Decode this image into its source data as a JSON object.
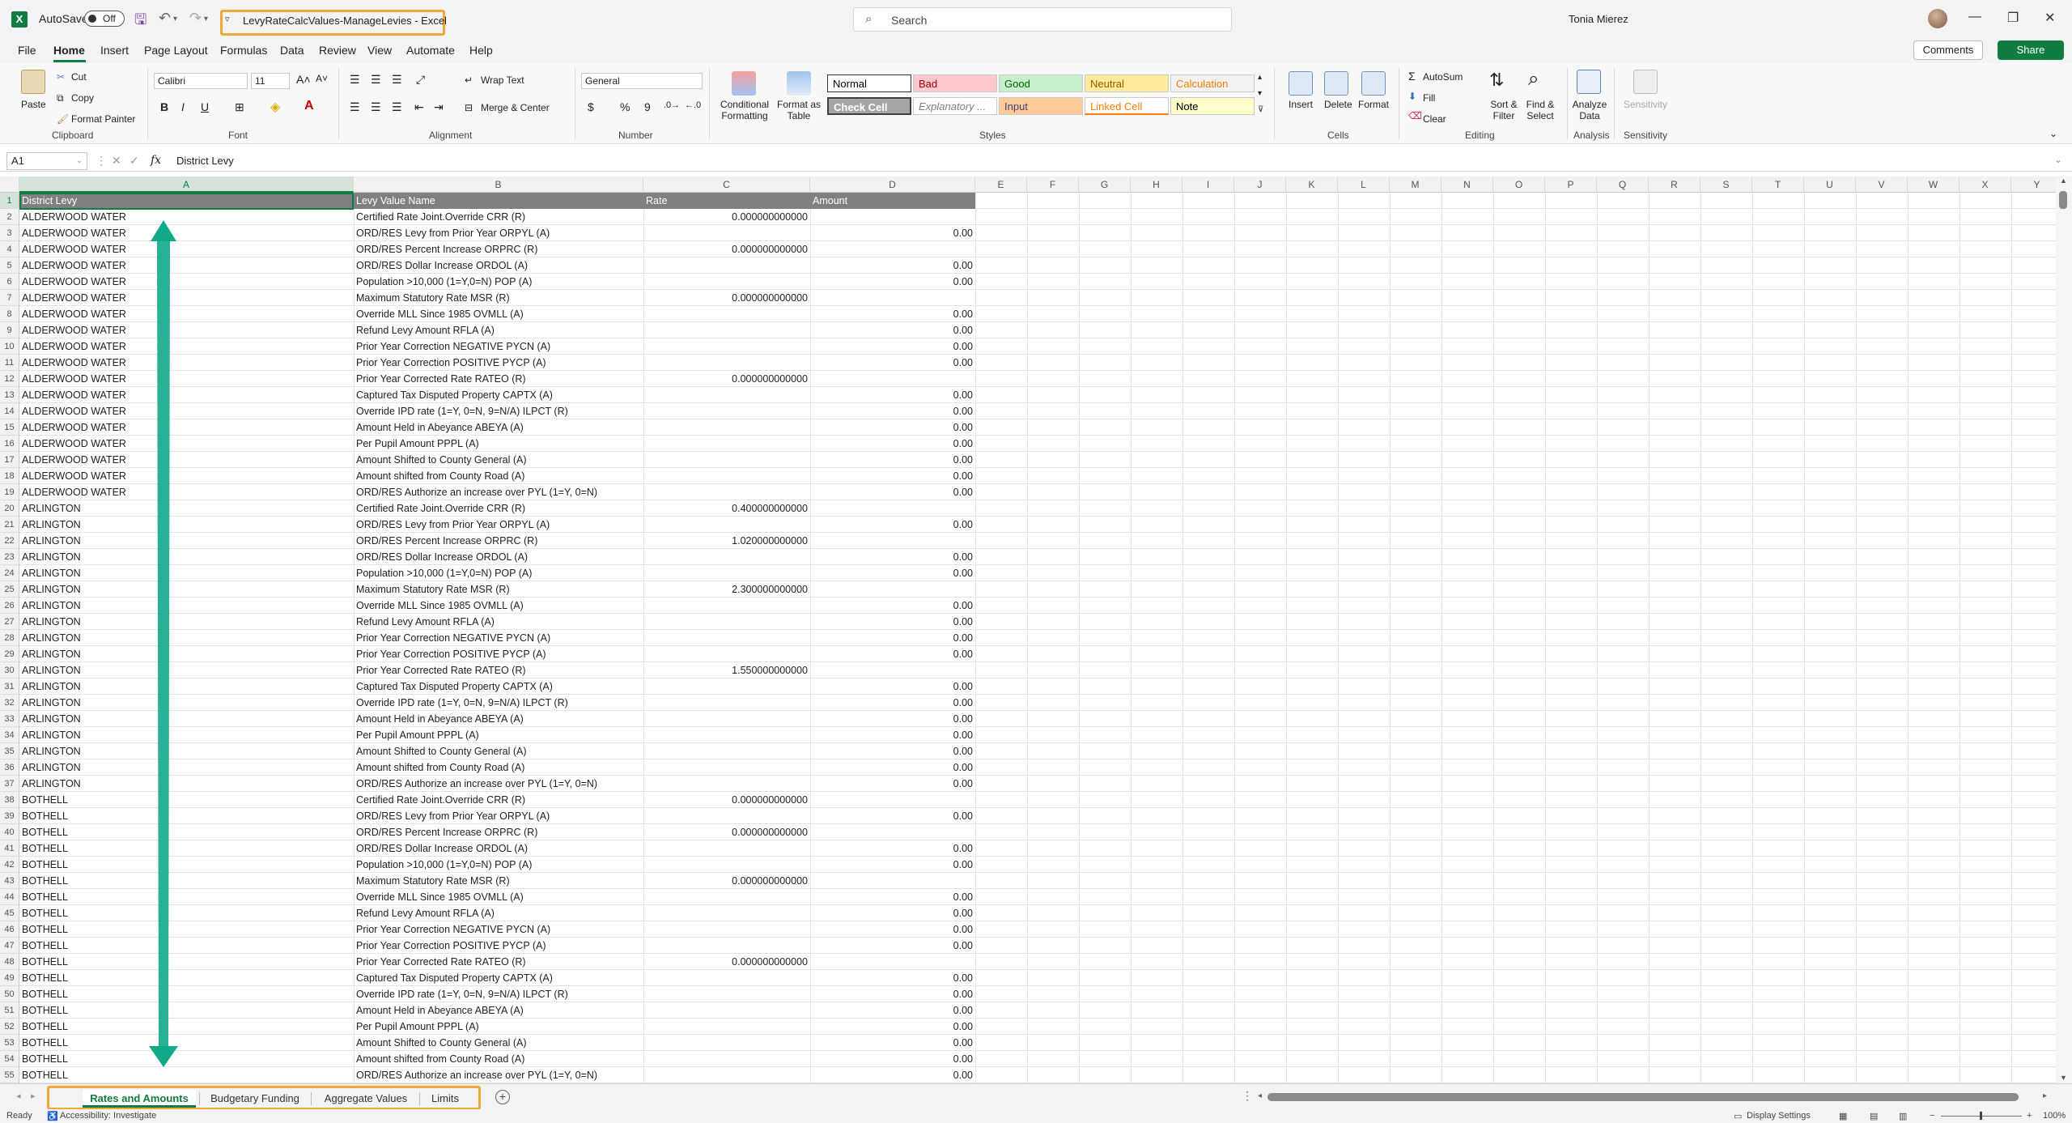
{
  "titlebar": {
    "autosave_label": "AutoSave",
    "autosave_state": "Off",
    "document_title": "LevyRateCalcValues-ManageLevies  -  Excel",
    "search_placeholder": "Search",
    "user_name": "Tonia Mierez"
  },
  "menu": {
    "tabs": [
      "File",
      "Home",
      "Insert",
      "Page Layout",
      "Formulas",
      "Data",
      "Review",
      "View",
      "Automate",
      "Help"
    ],
    "active_tab": "Home",
    "comments_label": "Comments",
    "share_label": "Share"
  },
  "ribbon": {
    "clipboard": {
      "paste": "Paste",
      "cut": "Cut",
      "copy": "Copy",
      "format_painter": "Format Painter",
      "label": "Clipboard"
    },
    "font": {
      "name": "Calibri",
      "size": "11",
      "label": "Font",
      "bold": "B",
      "italic": "I",
      "underline": "U"
    },
    "alignment": {
      "wrap_text": "Wrap Text",
      "merge_center": "Merge & Center",
      "label": "Alignment"
    },
    "number": {
      "format": "General",
      "label": "Number",
      "currency": "$",
      "percent": "%",
      "comma": "9"
    },
    "styles": {
      "conditional_formatting": "Conditional Formatting",
      "format_as_table": "Format as Table",
      "label": "Styles",
      "cells": [
        {
          "name": "Normal",
          "bg": "#ffffff",
          "color": "#000000"
        },
        {
          "name": "Bad",
          "bg": "#ffc7ce",
          "color": "#9c0006"
        },
        {
          "name": "Good",
          "bg": "#c6efce",
          "color": "#006100"
        },
        {
          "name": "Neutral",
          "bg": "#ffeb9c",
          "color": "#9c5700"
        },
        {
          "name": "Calculation",
          "bg": "#f2f2f2",
          "color": "#fa7d00"
        },
        {
          "name": "Check Cell",
          "bg": "#a5a5a5",
          "color": "#ffffff"
        },
        {
          "name": "Explanatory ...",
          "bg": "#ffffff",
          "color": "#7f7f7f"
        },
        {
          "name": "Input",
          "bg": "#ffcc99",
          "color": "#3f3f76"
        },
        {
          "name": "Linked Cell",
          "bg": "#ffffff",
          "color": "#fa7d00"
        },
        {
          "name": "Note",
          "bg": "#ffffcc",
          "color": "#000000"
        }
      ]
    },
    "cells": {
      "insert": "Insert",
      "delete": "Delete",
      "format": "Format",
      "label": "Cells"
    },
    "editing": {
      "autosum": "AutoSum",
      "fill": "Fill",
      "clear": "Clear",
      "sort_filter": "Sort & Filter",
      "find_select": "Find & Select",
      "label": "Editing"
    },
    "analysis": {
      "analyze_data": "Analyze Data",
      "label": "Analysis"
    },
    "sensitivity": {
      "sensitivity": "Sensitivity",
      "label": "Sensitivity"
    }
  },
  "formula_bar": {
    "name_box": "A1",
    "fx": "fx",
    "content": "District Levy"
  },
  "columns": [
    "A",
    "B",
    "C",
    "D",
    "E",
    "F",
    "G",
    "H",
    "I",
    "J",
    "K",
    "L",
    "M",
    "N",
    "O",
    "P",
    "Q",
    "R",
    "S",
    "T",
    "U",
    "V",
    "W",
    "X",
    "Y"
  ],
  "header_row": [
    "District Levy",
    "Levy Value Name",
    "Rate",
    "Amount"
  ],
  "rows": [
    [
      "ALDERWOOD WATER",
      "Certified Rate Joint.Override CRR (R)",
      "0.000000000000",
      ""
    ],
    [
      "ALDERWOOD WATER",
      "ORD/RES Levy from Prior Year ORPYL (A)",
      "",
      "0.00"
    ],
    [
      "ALDERWOOD WATER",
      "ORD/RES Percent Increase ORPRC (R)",
      "0.000000000000",
      ""
    ],
    [
      "ALDERWOOD WATER",
      "ORD/RES Dollar Increase ORDOL (A)",
      "",
      "0.00"
    ],
    [
      "ALDERWOOD WATER",
      "Population >10,000 (1=Y,0=N) POP (A)",
      "",
      "0.00"
    ],
    [
      "ALDERWOOD WATER",
      "Maximum Statutory Rate MSR (R)",
      "0.000000000000",
      ""
    ],
    [
      "ALDERWOOD WATER",
      "Override MLL Since 1985 OVMLL (A)",
      "",
      "0.00"
    ],
    [
      "ALDERWOOD WATER",
      "Refund Levy Amount  RFLA (A)",
      "",
      "0.00"
    ],
    [
      "ALDERWOOD WATER",
      "Prior Year Correction NEGATIVE  PYCN (A)",
      "",
      "0.00"
    ],
    [
      "ALDERWOOD WATER",
      "Prior Year Correction POSITIVE PYCP (A)",
      "",
      "0.00"
    ],
    [
      "ALDERWOOD WATER",
      "Prior Year Corrected Rate RATEO (R)",
      "0.000000000000",
      ""
    ],
    [
      "ALDERWOOD WATER",
      "Captured Tax Disputed Property CAPTX (A)",
      "",
      "0.00"
    ],
    [
      "ALDERWOOD WATER",
      "Override IPD rate (1=Y, 0=N, 9=N/A) ILPCT (R)",
      "",
      "0.00"
    ],
    [
      "ALDERWOOD WATER",
      "Amount Held in Abeyance ABEYA (A)",
      "",
      "0.00"
    ],
    [
      "ALDERWOOD WATER",
      "Per Pupil Amount  PPPL (A)",
      "",
      "0.00"
    ],
    [
      "ALDERWOOD WATER",
      "Amount Shifted to County General (A)",
      "",
      "0.00"
    ],
    [
      "ALDERWOOD WATER",
      "Amount shifted from County Road (A)",
      "",
      "0.00"
    ],
    [
      "ALDERWOOD WATER",
      "ORD/RES Authorize an increase over PYL (1=Y, 0=N)",
      "",
      "0.00"
    ],
    [
      "ARLINGTON",
      "Certified Rate Joint.Override CRR (R)",
      "0.400000000000",
      ""
    ],
    [
      "ARLINGTON",
      "ORD/RES Levy from Prior Year ORPYL (A)",
      "",
      "0.00"
    ],
    [
      "ARLINGTON",
      "ORD/RES Percent Increase ORPRC (R)",
      "1.020000000000",
      ""
    ],
    [
      "ARLINGTON",
      "ORD/RES Dollar Increase ORDOL (A)",
      "",
      "0.00"
    ],
    [
      "ARLINGTON",
      "Population >10,000 (1=Y,0=N) POP (A)",
      "",
      "0.00"
    ],
    [
      "ARLINGTON",
      "Maximum Statutory Rate MSR (R)",
      "2.300000000000",
      ""
    ],
    [
      "ARLINGTON",
      "Override MLL Since 1985 OVMLL (A)",
      "",
      "0.00"
    ],
    [
      "ARLINGTON",
      "Refund Levy Amount  RFLA (A)",
      "",
      "0.00"
    ],
    [
      "ARLINGTON",
      "Prior Year Correction NEGATIVE  PYCN (A)",
      "",
      "0.00"
    ],
    [
      "ARLINGTON",
      "Prior Year Correction POSITIVE PYCP (A)",
      "",
      "0.00"
    ],
    [
      "ARLINGTON",
      "Prior Year Corrected Rate RATEO (R)",
      "1.550000000000",
      ""
    ],
    [
      "ARLINGTON",
      "Captured Tax Disputed Property CAPTX (A)",
      "",
      "0.00"
    ],
    [
      "ARLINGTON",
      "Override IPD rate (1=Y, 0=N, 9=N/A) ILPCT (R)",
      "",
      "0.00"
    ],
    [
      "ARLINGTON",
      "Amount Held in Abeyance ABEYA (A)",
      "",
      "0.00"
    ],
    [
      "ARLINGTON",
      "Per Pupil Amount  PPPL (A)",
      "",
      "0.00"
    ],
    [
      "ARLINGTON",
      "Amount Shifted to County General (A)",
      "",
      "0.00"
    ],
    [
      "ARLINGTON",
      "Amount shifted from County Road (A)",
      "",
      "0.00"
    ],
    [
      "ARLINGTON",
      "ORD/RES Authorize an increase over PYL (1=Y, 0=N)",
      "",
      "0.00"
    ],
    [
      "BOTHELL",
      "Certified Rate Joint.Override CRR (R)",
      "0.000000000000",
      ""
    ],
    [
      "BOTHELL",
      "ORD/RES Levy from Prior Year ORPYL (A)",
      "",
      "0.00"
    ],
    [
      "BOTHELL",
      "ORD/RES Percent Increase ORPRC (R)",
      "0.000000000000",
      ""
    ],
    [
      "BOTHELL",
      "ORD/RES Dollar Increase ORDOL (A)",
      "",
      "0.00"
    ],
    [
      "BOTHELL",
      "Population >10,000 (1=Y,0=N) POP (A)",
      "",
      "0.00"
    ],
    [
      "BOTHELL",
      "Maximum Statutory Rate MSR (R)",
      "0.000000000000",
      ""
    ],
    [
      "BOTHELL",
      "Override MLL Since 1985 OVMLL (A)",
      "",
      "0.00"
    ],
    [
      "BOTHELL",
      "Refund Levy Amount  RFLA (A)",
      "",
      "0.00"
    ],
    [
      "BOTHELL",
      "Prior Year Correction NEGATIVE  PYCN (A)",
      "",
      "0.00"
    ],
    [
      "BOTHELL",
      "Prior Year Correction POSITIVE PYCP (A)",
      "",
      "0.00"
    ],
    [
      "BOTHELL",
      "Prior Year Corrected Rate RATEO (R)",
      "0.000000000000",
      ""
    ],
    [
      "BOTHELL",
      "Captured Tax Disputed Property CAPTX (A)",
      "",
      "0.00"
    ],
    [
      "BOTHELL",
      "Override IPD rate (1=Y, 0=N, 9=N/A) ILPCT (R)",
      "",
      "0.00"
    ],
    [
      "BOTHELL",
      "Amount Held in Abeyance ABEYA (A)",
      "",
      "0.00"
    ],
    [
      "BOTHELL",
      "Per Pupil Amount  PPPL (A)",
      "",
      "0.00"
    ],
    [
      "BOTHELL",
      "Amount Shifted to County General (A)",
      "",
      "0.00"
    ],
    [
      "BOTHELL",
      "Amount shifted from County Road (A)",
      "",
      "0.00"
    ],
    [
      "BOTHELL",
      "ORD/RES Authorize an increase over PYL (1=Y, 0=N)",
      "",
      "0.00"
    ]
  ],
  "sheet_tabs": [
    "Rates and Amounts",
    "Budgetary Funding",
    "Aggregate Values",
    "Limits"
  ],
  "active_sheet": "Rates and Amounts",
  "status": {
    "ready": "Ready",
    "accessibility": "Accessibility: Investigate",
    "display_settings": "Display Settings",
    "zoom": "100%"
  },
  "colors": {
    "accent": "#107c41",
    "highlight": "#f0a83a",
    "arrow": "#12a88a",
    "header_fill": "#808080"
  }
}
